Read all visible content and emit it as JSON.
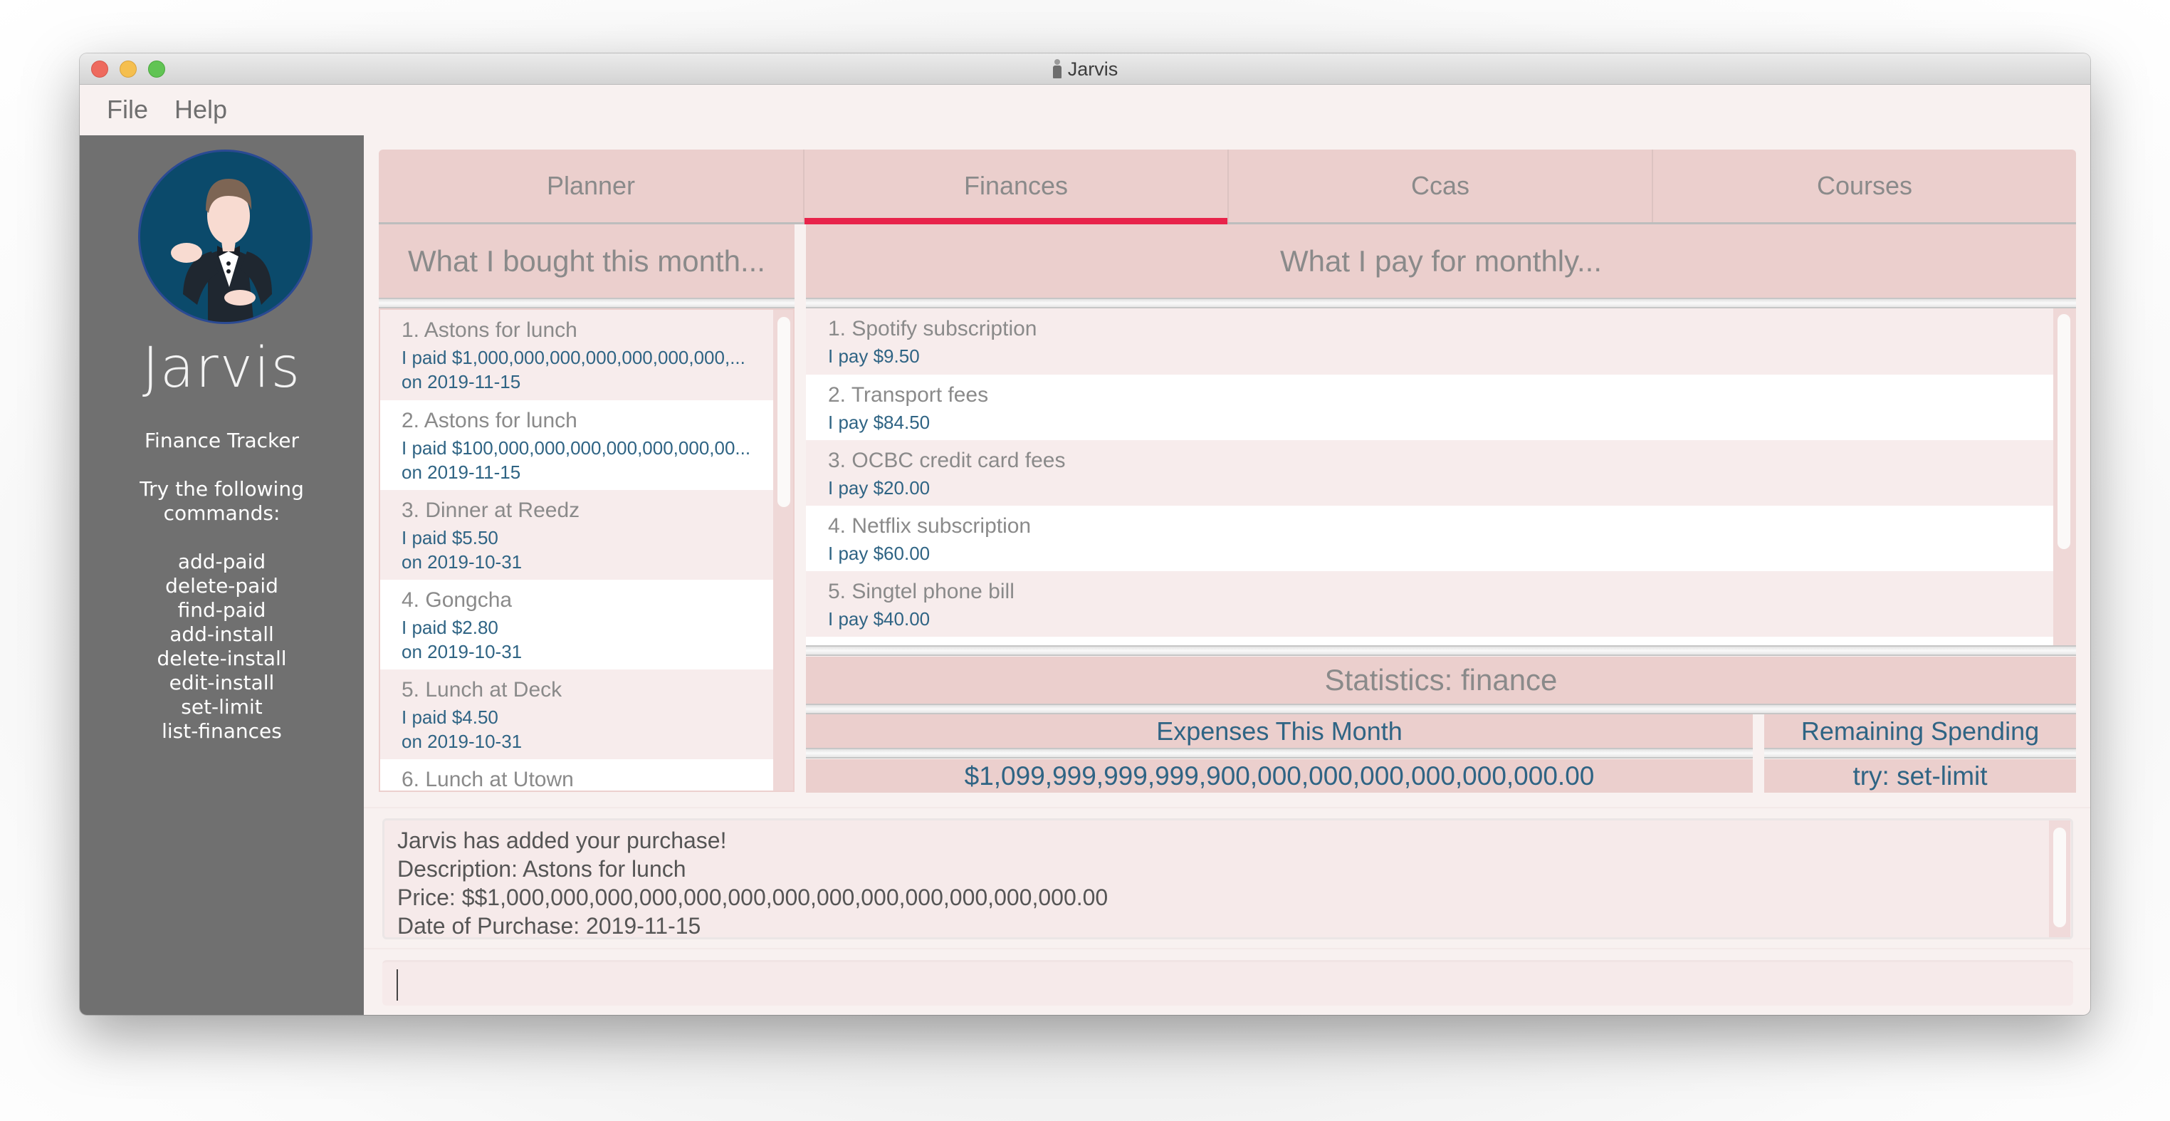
{
  "window": {
    "title": "Jarvis",
    "title_icon": "butler-icon"
  },
  "menu": {
    "items": [
      {
        "label": "File"
      },
      {
        "label": "Help"
      }
    ]
  },
  "sidebar": {
    "avatar": "butler-avatar",
    "brand": "Jarvis",
    "subtitle": "Finance Tracker",
    "hint_line1": "Try the following",
    "hint_line2": "commands:",
    "commands": [
      "add-paid",
      "delete-paid",
      "find-paid",
      "add-install",
      "delete-install",
      "edit-install",
      "set-limit",
      "list-finances"
    ]
  },
  "tabs": [
    {
      "label": "Planner",
      "active": false
    },
    {
      "label": "Finances",
      "active": true
    },
    {
      "label": "Ccas",
      "active": false
    },
    {
      "label": "Courses",
      "active": false
    }
  ],
  "colors": {
    "accent": "#e8234a",
    "panel": "#ebcfcd",
    "price_text": "#2f6484",
    "title_text": "#8a8a8a",
    "sidebar_bg": "#707070"
  },
  "purchases": {
    "header": "What I bought this month...",
    "items": [
      {
        "title": "1.  Astons for lunch",
        "price": "I paid $1,000,000,000,000,000,000,000,...",
        "date": "on 2019-11-15"
      },
      {
        "title": "2.  Astons for lunch",
        "price": "I paid $100,000,000,000,000,000,000,00...",
        "date": "on 2019-11-15"
      },
      {
        "title": "3.  Dinner at Reedz",
        "price": "I paid $5.50",
        "date": "on 2019-10-31"
      },
      {
        "title": "4.  Gongcha",
        "price": "I paid $2.80",
        "date": "on 2019-10-31"
      },
      {
        "title": "5.  Lunch at Deck",
        "price": "I paid $4.50",
        "date": "on 2019-10-31"
      },
      {
        "title": "6.  Lunch at Utown",
        "price": "",
        "date": ""
      }
    ]
  },
  "installments": {
    "header": "What I pay for monthly...",
    "items": [
      {
        "title": "1. Spotify subscription",
        "price": "I pay $9.50"
      },
      {
        "title": "2.  Transport fees",
        "price": "I pay $84.50"
      },
      {
        "title": "3.  OCBC credit card fees",
        "price": "I pay $20.00"
      },
      {
        "title": "4.  Netflix subscription",
        "price": "I pay $60.00"
      },
      {
        "title": "5.  Singtel phone bill",
        "price": "I pay $40.00"
      }
    ]
  },
  "statistics": {
    "title": "Statistics: finance",
    "expenses_label": "Expenses This Month",
    "expenses_value": "$1,099,999,999,999,900,000,000,000,000,000,000.00",
    "remaining_label": "Remaining Spending",
    "remaining_value": "try: set-limit"
  },
  "result": {
    "lines": [
      "Jarvis has added your purchase!",
      "Description: Astons for lunch",
      "Price: $$1,000,000,000,000,000,000,000,000,000,000,000,000,000.00",
      "Date of Purchase: 2019-11-15"
    ]
  },
  "command": {
    "value": "",
    "placeholder": ""
  }
}
